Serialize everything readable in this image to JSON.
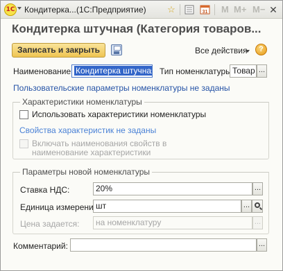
{
  "window": {
    "title": "Кондитерка...",
    "app_name": "(1С:Предприятие)",
    "toolbar_icons": [
      "star-icon",
      "calendar-list-icon",
      "calendar-31-icon"
    ],
    "memory_buttons": [
      "M",
      "M+",
      "M−"
    ],
    "minimize": "—",
    "close": "✕",
    "logo_text": "1С",
    "calendar_day": "31"
  },
  "form": {
    "title": "Кондитерка штучная (Категория товаров...",
    "save_close_label": "Записать и закрыть",
    "all_actions_label": "Все действия",
    "help_label": "?"
  },
  "fields": {
    "name_label": "Наименование:",
    "name_value": "Кондитерка штучная",
    "type_label": "Тип номенклатуры:",
    "type_value": "Товар",
    "custom_params_link": "Пользовательские параметры номенклатуры не заданы"
  },
  "characteristics_group": {
    "title": "Характеристики номенклатуры",
    "use_characteristics_label": "Использовать характеристики номенклатуры",
    "use_characteristics_checked": false,
    "properties_link": "Свойства характеристик не заданы",
    "include_names_label": "Включать наименования свойств в наименование характеристики",
    "include_names_checked": false
  },
  "new_item_group": {
    "title": "Параметры новой номенклатуры",
    "vat_label": "Ставка НДС:",
    "vat_value": "20%",
    "unit_label": "Единица измерения:",
    "unit_value": "шт",
    "price_label": "Цена задается:",
    "price_value": "на номенклатуру"
  },
  "comment": {
    "label": "Комментарий:",
    "value": ""
  },
  "ellipsis": "..."
}
